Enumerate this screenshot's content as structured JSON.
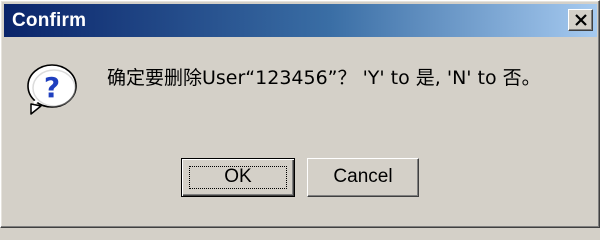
{
  "window": {
    "title": "Confirm",
    "close_glyph": "✕",
    "icon": "question-icon",
    "colors": {
      "face": "#d4d0c8",
      "title_start": "#0a246a",
      "title_end": "#a6caf0",
      "icon_blue": "#1f3fbf"
    }
  },
  "message": {
    "text": "确定要删除User“123456”？ 'Y' to 是, 'N' to 否。"
  },
  "buttons": {
    "ok_label": "OK",
    "cancel_label": "Cancel"
  }
}
